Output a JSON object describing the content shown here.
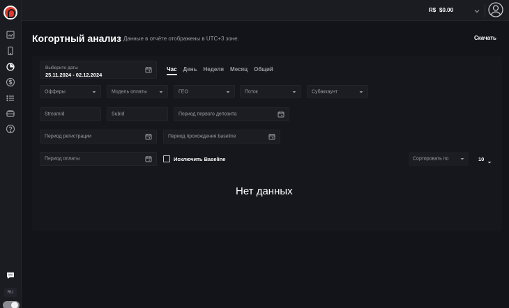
{
  "sidebar": {
    "lang": "RU"
  },
  "topbar": {
    "currency": "R$",
    "balance": "$0.00"
  },
  "header": {
    "title": "Когортный анализ",
    "subtitle": "Данные в отчёте отображены в UTC+3 зоне.",
    "download": "Скачать"
  },
  "filters": {
    "date_label": "Выберите даты",
    "date_value": "25.11.2024 - 02.12.2024",
    "tabs": [
      "Час",
      "День",
      "Неделя",
      "Месяц",
      "Общий"
    ],
    "offers": "Офферы",
    "payment_model": "Модель оплаты",
    "geo": "ГЕО",
    "stream": "Поток",
    "subaccount": "Субаккаунт",
    "streamid": "StreamId",
    "subid": "SubId",
    "first_deposit_period": "Период первого депозита",
    "registration_period": "Период регистрации",
    "baseline_period": "Период прохождения baseline",
    "payment_period": "Период оплаты",
    "exclude_baseline": "Исключить Baseline",
    "sort_by": "Сортировать по",
    "per_page": "10"
  },
  "result": {
    "empty": "Нет данных"
  },
  "colors": {
    "background": "#131419",
    "panel": "#16171c",
    "logo": "#e03a2c"
  }
}
